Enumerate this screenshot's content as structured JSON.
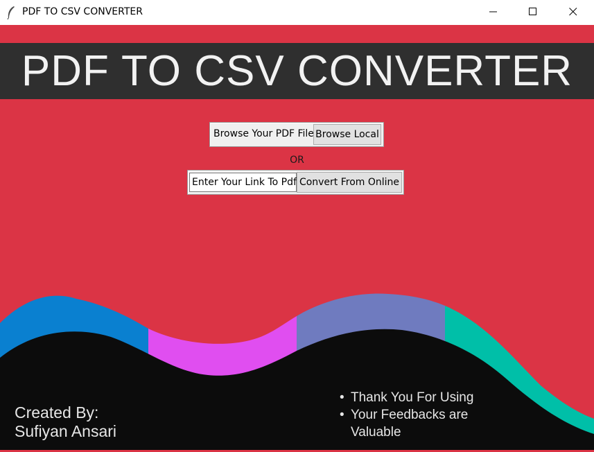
{
  "window": {
    "title": "PDF TO CSV CONVERTER",
    "icon": "feather-icon",
    "controls": [
      "minimize-icon",
      "maximize-icon",
      "close-icon"
    ]
  },
  "banner": {
    "title": "PDF TO CSV CONVERTER"
  },
  "local": {
    "label": "Browse Your PDF File",
    "button": "Browse Local"
  },
  "separator": "OR",
  "online": {
    "input_value": "Enter Your Link To Pdf",
    "button": "Convert From Online"
  },
  "footer": {
    "credit_line1": "Created By:",
    "credit_line2": "Sufiyan Ansari",
    "bullets": [
      "Thank You For Using",
      "Your Feedbacks are",
      "Valuable"
    ]
  },
  "colors": {
    "background": "#db3445",
    "banner": "#2f2f2f",
    "wave_blue": "#0a80d0",
    "wave_magenta": "#e04ef0",
    "wave_slate": "#6f7bbf",
    "wave_teal": "#00bfa8",
    "footer_dark": "#0c0c0c"
  }
}
